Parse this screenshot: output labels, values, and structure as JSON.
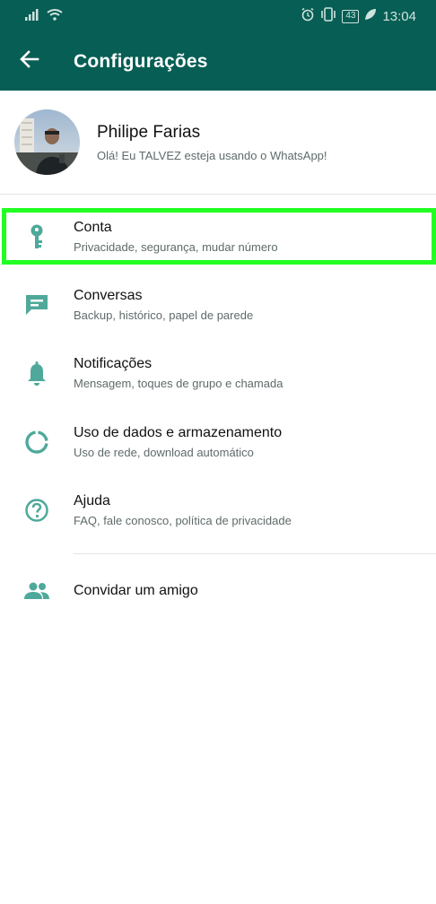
{
  "status_bar": {
    "battery": "43",
    "time": "13:04"
  },
  "header": {
    "title": "Configurações"
  },
  "profile": {
    "name": "Philipe Farias",
    "status": "Olá! Eu TALVEZ esteja usando o WhatsApp!"
  },
  "menu": {
    "items": [
      {
        "label": "Conta",
        "subtitle": "Privacidade, segurança, mudar número",
        "icon": "key-icon"
      },
      {
        "label": "Conversas",
        "subtitle": "Backup, histórico, papel de parede",
        "icon": "chat-icon"
      },
      {
        "label": "Notificações",
        "subtitle": "Mensagem, toques de grupo e chamada",
        "icon": "bell-icon"
      },
      {
        "label": "Uso de dados e armazenamento",
        "subtitle": "Uso de rede, download automático",
        "icon": "data-usage-icon"
      },
      {
        "label": "Ajuda",
        "subtitle": "FAQ, fale conosco, política de privacidade",
        "icon": "help-icon"
      }
    ],
    "invite": {
      "label": "Convidar um amigo",
      "icon": "people-icon"
    }
  },
  "colors": {
    "header_bg": "#075e54",
    "icon": "#4fa99a",
    "highlight": "#22ff22"
  }
}
